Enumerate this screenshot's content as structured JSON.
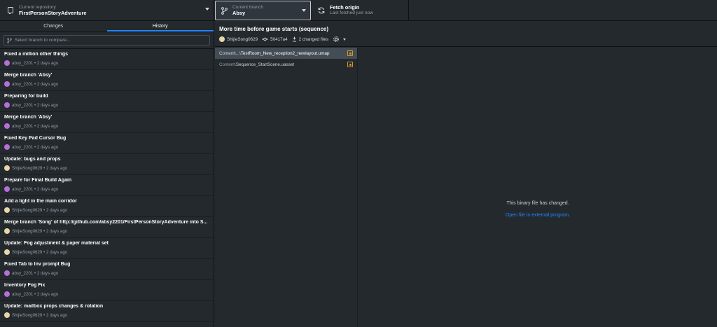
{
  "toolbar": {
    "repo": {
      "label": "Current repository",
      "name": "FirstPersonStoryAdventure"
    },
    "branch": {
      "label": "Current branch",
      "name": "Absy"
    },
    "fetch": {
      "label": "Fetch origin",
      "status": "Last fetched just now"
    }
  },
  "tabs": [
    {
      "label": "Changes",
      "active": false
    },
    {
      "label": "History",
      "active": true
    }
  ],
  "compare": {
    "placeholder": "Select branch to compare..."
  },
  "colors": {
    "accent": "#2188ff",
    "modified": "#d29922",
    "avatar_absy": "#b56fd6",
    "avatar_shijie": "#e8d6a8"
  },
  "commits": [
    {
      "title": "Fixed a million other things",
      "author": "absy_2201",
      "time": "2 days ago",
      "avatar": "absy"
    },
    {
      "title": "Merge branch 'Absy'",
      "author": "absy_2201",
      "time": "2 days ago",
      "avatar": "absy"
    },
    {
      "title": "Preparing for build",
      "author": "absy_2201",
      "time": "2 days ago",
      "avatar": "absy"
    },
    {
      "title": "Merge branch 'Absy'",
      "author": "absy_2201",
      "time": "2 days ago",
      "avatar": "absy"
    },
    {
      "title": "Fixed Key Pad Cursor Bug",
      "author": "absy_2201",
      "time": "2 days ago",
      "avatar": "absy"
    },
    {
      "title": "Update: bugs and props",
      "author": "ShijieSong0629",
      "time": "2 days ago",
      "avatar": "shijie"
    },
    {
      "title": "Prepare for Final Build Again",
      "author": "absy_2201",
      "time": "2 days ago",
      "avatar": "absy"
    },
    {
      "title": "Add a light in the main corridor",
      "author": "ShijieSong0629",
      "time": "2 days ago",
      "avatar": "shijie"
    },
    {
      "title": "Merge branch 'Song' of http://github.com/absy2201/FirstPersonStoryAdventure into S...",
      "author": "ShijieSong0629",
      "time": "2 days ago",
      "avatar": "shijie"
    },
    {
      "title": "Update: Fog adjustment & paper material set",
      "author": "ShijieSong0629",
      "time": "2 days ago",
      "avatar": "shijie"
    },
    {
      "title": "Fixed Tab to Inv prompt Bug",
      "author": "absy_2201",
      "time": "2 days ago",
      "avatar": "absy"
    },
    {
      "title": "Inventory Fog Fix",
      "author": "absy_2201",
      "time": "2 days ago",
      "avatar": "absy"
    },
    {
      "title": "Update: mailbox props changes & rotation",
      "author": "ShijieSong0629",
      "time": "2 days ago",
      "avatar": "shijie"
    }
  ],
  "detail": {
    "title": "More time before game starts (sequence)",
    "author": "ShijieSong0629",
    "sha": "50417a4",
    "changed": "2 changed files",
    "files": [
      {
        "dir": "Content\\...\\",
        "name": "TestRoom_New_reception2_newlayout.umap",
        "selected": true
      },
      {
        "dir": "Content\\",
        "name": "Sequence_StartScene.uasset",
        "selected": false
      }
    ],
    "binary_msg": "This binary file has changed.",
    "open_link": "Open file in external program."
  }
}
